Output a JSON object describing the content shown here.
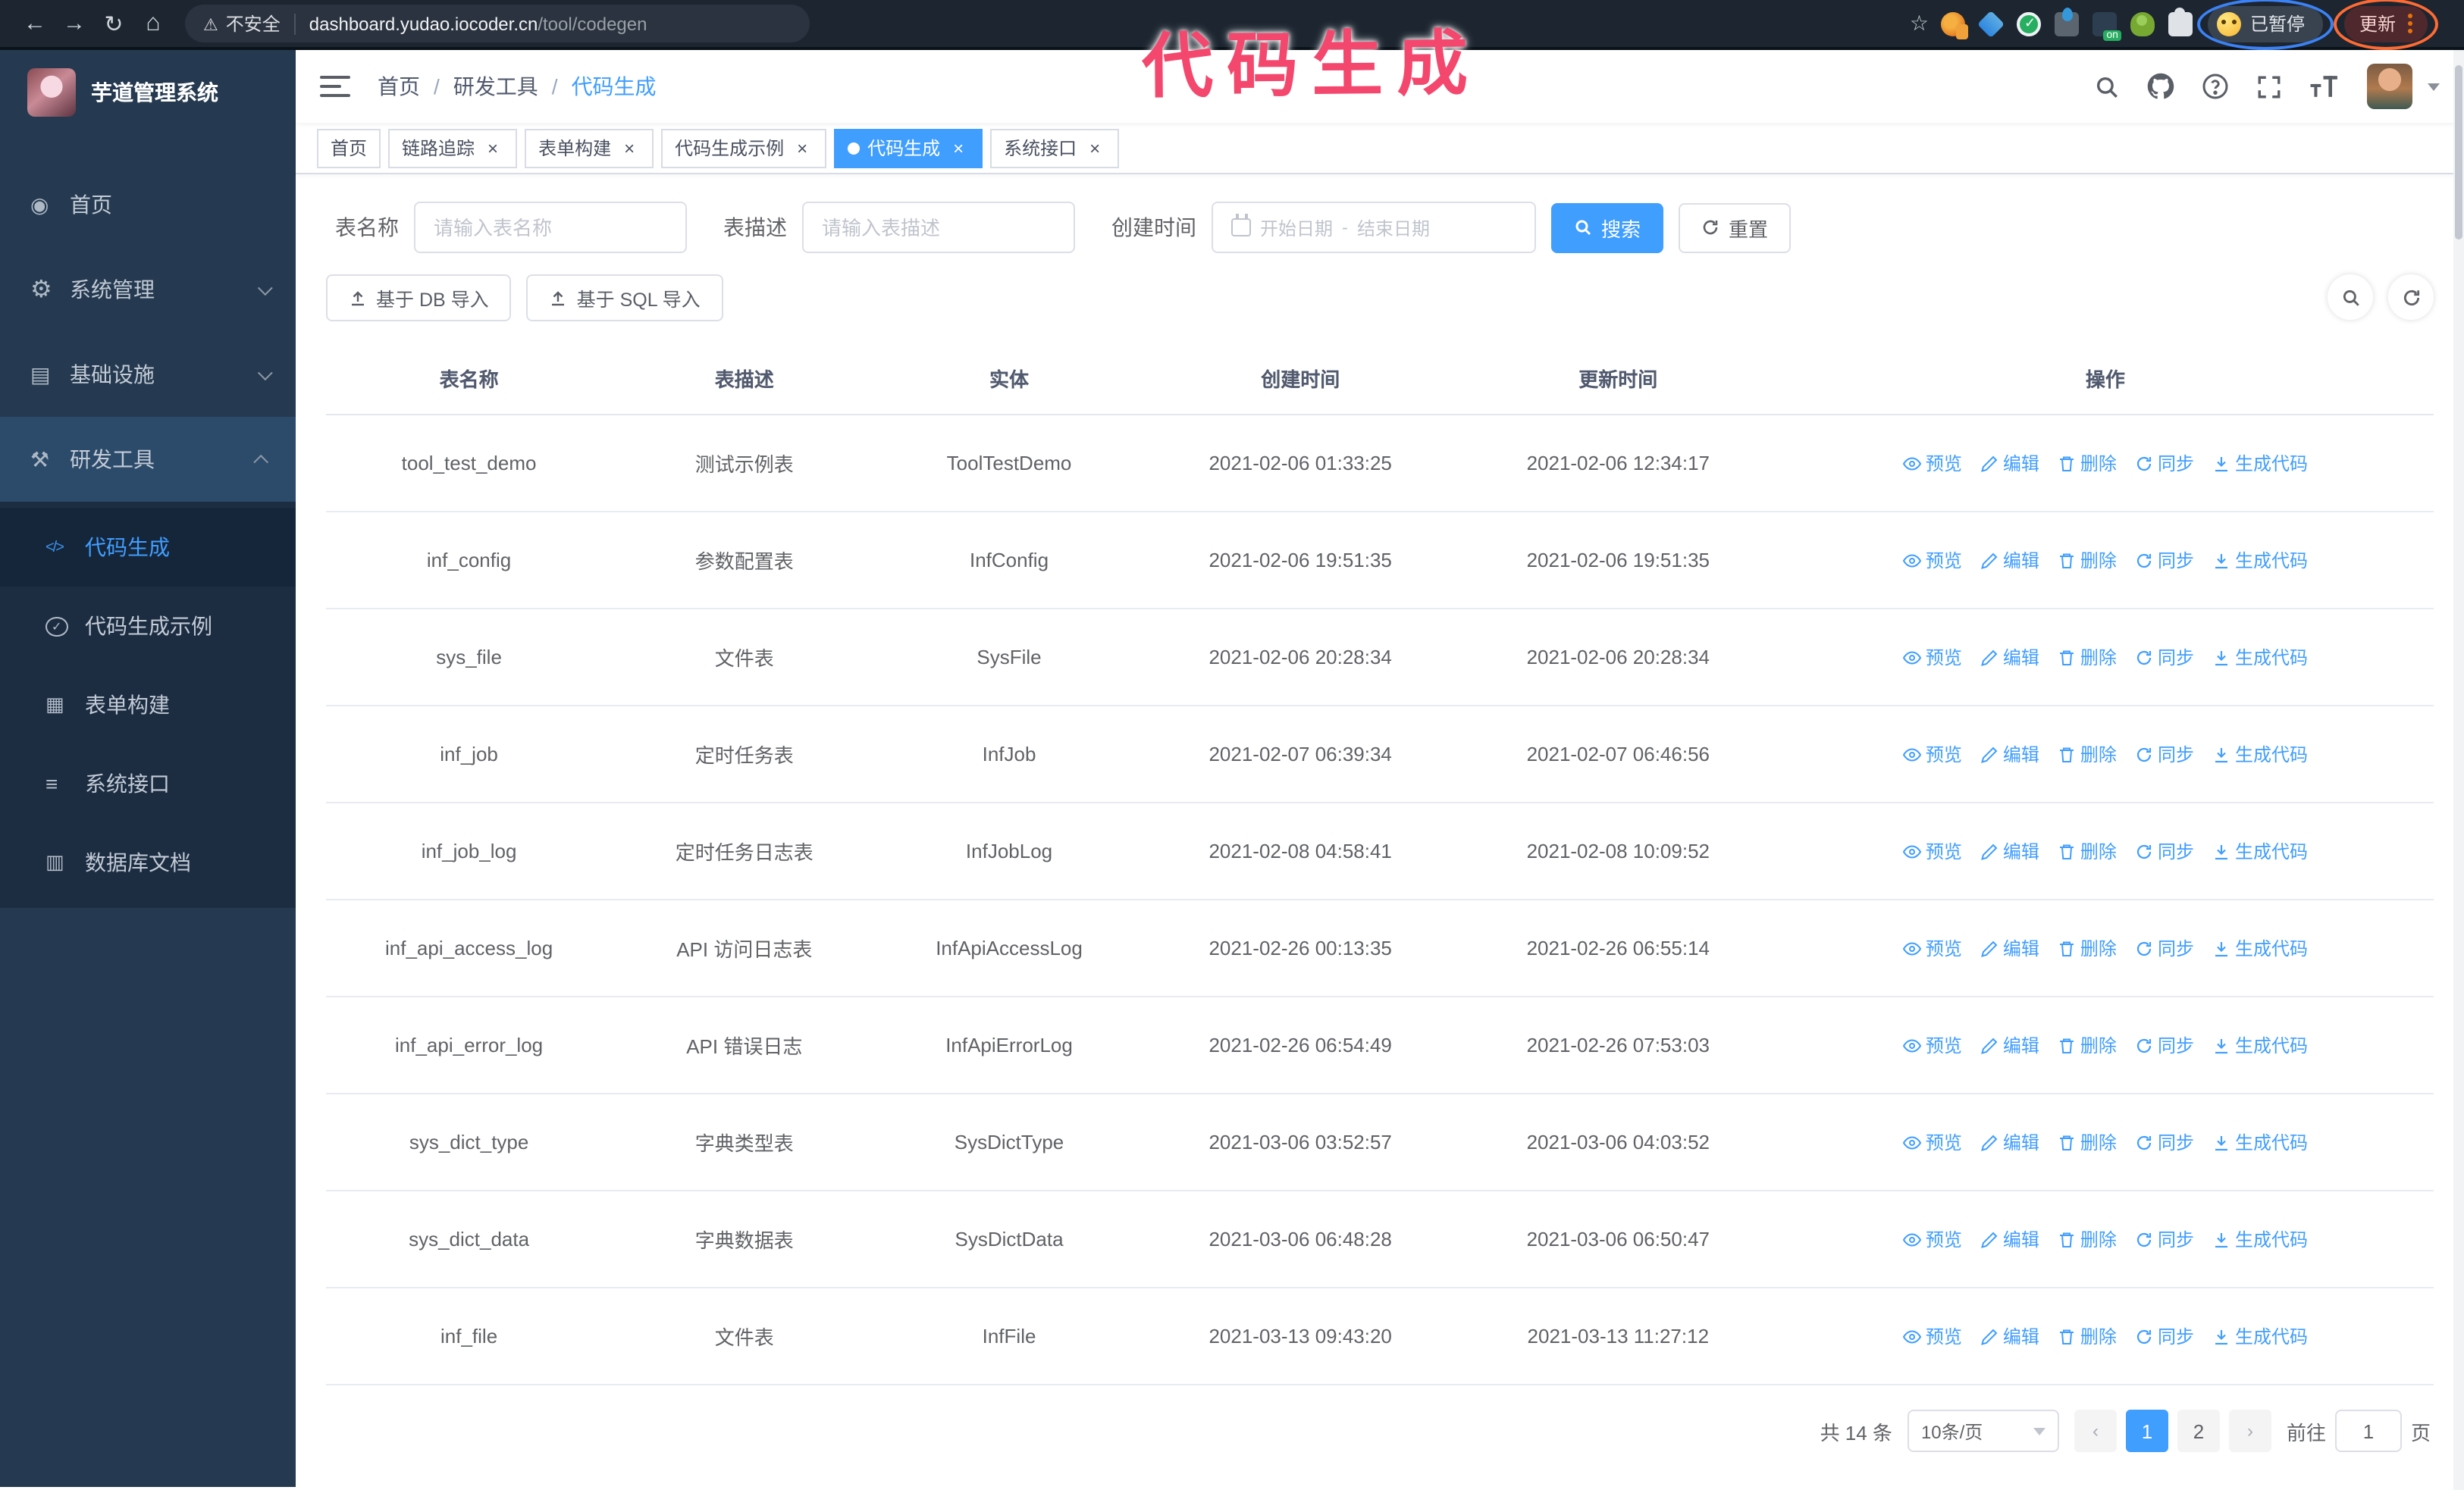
{
  "colors": {
    "accent": "#409eff",
    "annotation-pink": "#f4476d",
    "oval-blue": "#3b82f6",
    "oval-orange": "#ff6a33"
  },
  "browser": {
    "security_label": "不安全",
    "url_host": "dashboard.yudao.iocoder.cn",
    "url_path": "/tool/codegen",
    "paused_badge": "已暂停",
    "update_button": "更新"
  },
  "annotation": {
    "text": "代码生成"
  },
  "sidebar": {
    "logo_title": "芋道管理系统",
    "items": [
      {
        "label": "首页",
        "icon": "i-home",
        "chevron": "",
        "active": false
      },
      {
        "label": "系统管理",
        "icon": "i-gear",
        "chevron": "down",
        "active": false
      },
      {
        "label": "基础设施",
        "icon": "i-monitor",
        "chevron": "down",
        "active": false
      },
      {
        "label": "研发工具",
        "icon": "i-toolbox",
        "chevron": "up",
        "active": true
      }
    ],
    "sub_items": [
      {
        "label": "代码生成",
        "icon": "i-code",
        "active": true
      },
      {
        "label": "代码生成示例",
        "icon": "i-example",
        "active": false
      },
      {
        "label": "表单构建",
        "icon": "i-form",
        "active": false
      },
      {
        "label": "系统接口",
        "icon": "i-api",
        "active": false
      },
      {
        "label": "数据库文档",
        "icon": "i-dbdoc",
        "active": false
      }
    ]
  },
  "header": {
    "breadcrumb_home": "首页",
    "breadcrumb_section": "研发工具",
    "breadcrumb_current": "代码生成"
  },
  "tabs": [
    {
      "label": "首页",
      "closable": false,
      "active": false
    },
    {
      "label": "链路追踪",
      "closable": true,
      "active": false
    },
    {
      "label": "表单构建",
      "closable": true,
      "active": false
    },
    {
      "label": "代码生成示例",
      "closable": true,
      "active": false
    },
    {
      "label": "代码生成",
      "closable": true,
      "active": true
    },
    {
      "label": "系统接口",
      "closable": true,
      "active": false
    }
  ],
  "search_form": {
    "name_label": "表名称",
    "name_placeholder": "请输入表名称",
    "desc_label": "表描述",
    "desc_placeholder": "请输入表描述",
    "time_label": "创建时间",
    "start_placeholder": "开始日期",
    "range_separator": "-",
    "end_placeholder": "结束日期",
    "search_button": "搜索",
    "reset_button": "重置"
  },
  "toolbar": {
    "import_db_button": "基于 DB 导入",
    "import_sql_button": "基于 SQL 导入"
  },
  "table": {
    "columns": {
      "name": "表名称",
      "desc": "表描述",
      "entity": "实体",
      "created": "创建时间",
      "updated": "更新时间",
      "ops": "操作"
    },
    "action_labels": {
      "preview": "预览",
      "edit": "编辑",
      "delete": "删除",
      "sync": "同步",
      "generate": "生成代码"
    },
    "rows": [
      {
        "name": "tool_test_demo",
        "desc": "测试示例表",
        "entity": "ToolTestDemo",
        "created": "2021-02-06 01:33:25",
        "updated": "2021-02-06 12:34:17"
      },
      {
        "name": "inf_config",
        "desc": "参数配置表",
        "entity": "InfConfig",
        "created": "2021-02-06 19:51:35",
        "updated": "2021-02-06 19:51:35"
      },
      {
        "name": "sys_file",
        "desc": "文件表",
        "entity": "SysFile",
        "created": "2021-02-06 20:28:34",
        "updated": "2021-02-06 20:28:34"
      },
      {
        "name": "inf_job",
        "desc": "定时任务表",
        "entity": "InfJob",
        "created": "2021-02-07 06:39:34",
        "updated": "2021-02-07 06:46:56"
      },
      {
        "name": "inf_job_log",
        "desc": "定时任务日志表",
        "entity": "InfJobLog",
        "created": "2021-02-08 04:58:41",
        "updated": "2021-02-08 10:09:52"
      },
      {
        "name": "inf_api_access_log",
        "desc": "API 访问日志表",
        "entity": "InfApiAccessLog",
        "created": "2021-02-26 00:13:35",
        "updated": "2021-02-26 06:55:14"
      },
      {
        "name": "inf_api_error_log",
        "desc": "API 错误日志",
        "entity": "InfApiErrorLog",
        "created": "2021-02-26 06:54:49",
        "updated": "2021-02-26 07:53:03"
      },
      {
        "name": "sys_dict_type",
        "desc": "字典类型表",
        "entity": "SysDictType",
        "created": "2021-03-06 03:52:57",
        "updated": "2021-03-06 04:03:52"
      },
      {
        "name": "sys_dict_data",
        "desc": "字典数据表",
        "entity": "SysDictData",
        "created": "2021-03-06 06:48:28",
        "updated": "2021-03-06 06:50:47"
      },
      {
        "name": "inf_file",
        "desc": "文件表",
        "entity": "InfFile",
        "created": "2021-03-13 09:43:20",
        "updated": "2021-03-13 11:27:12"
      }
    ]
  },
  "pagination": {
    "total_text": "共 14 条",
    "page_size": "10条/页",
    "pages": [
      {
        "label": "1",
        "active": true
      },
      {
        "label": "2",
        "active": false
      }
    ],
    "goto_label": "前往",
    "goto_value": "1",
    "goto_suffix": "页"
  }
}
